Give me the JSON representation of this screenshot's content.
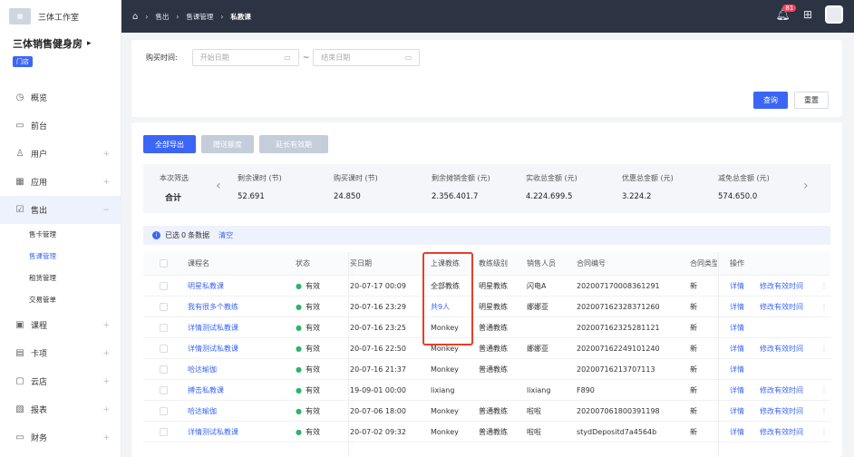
{
  "sidebar": {
    "brand": "三体工作室",
    "store_name": "三体销售健身房",
    "store_tag": "门店",
    "items": [
      {
        "label": "概览",
        "icon": "◷",
        "icon_name": "overview-icon",
        "expandable": false
      },
      {
        "label": "前台",
        "icon": "▭",
        "icon_name": "monitor-icon",
        "expandable": false
      },
      {
        "label": "用户",
        "icon": "♙",
        "icon_name": "user-icon",
        "expandable": true
      },
      {
        "label": "应用",
        "icon": "▦",
        "icon_name": "apps-icon",
        "expandable": true
      },
      {
        "label": "售出",
        "icon": "☑",
        "icon_name": "sales-icon",
        "expandable": true,
        "active": true
      }
    ],
    "sub_items": [
      {
        "label": "售卡管理",
        "active": false
      },
      {
        "label": "售课管理",
        "active": true
      },
      {
        "label": "租赁管理",
        "active": false
      },
      {
        "label": "交易管单",
        "active": false
      }
    ],
    "items2": [
      {
        "label": "课程",
        "icon": "▣",
        "icon_name": "course-icon"
      },
      {
        "label": "卡项",
        "icon": "▤",
        "icon_name": "card-icon"
      },
      {
        "label": "云店",
        "icon": "▢",
        "icon_name": "store-icon"
      },
      {
        "label": "报表",
        "icon": "▧",
        "icon_name": "report-icon"
      },
      {
        "label": "财务",
        "icon": "▭",
        "icon_name": "finance-icon"
      }
    ]
  },
  "topbar": {
    "breadcrumb": [
      "售出",
      "售课管理",
      "私教课"
    ],
    "badge": "81"
  },
  "filter": {
    "label": "购买时间:",
    "start_placeholder": "开始日期",
    "end_placeholder": "结束日期",
    "tilde": "~",
    "query": "查询",
    "reset": "重置"
  },
  "actions": {
    "export_all": "全部导出",
    "gift_quota": "赠送额度",
    "extend": "延长有效期"
  },
  "summary": {
    "label": "本次筛选",
    "total": "合计",
    "columns": [
      {
        "title": "剩余课时 (节)",
        "value": "52.691"
      },
      {
        "title": "购买课时 (节)",
        "value": "24.850"
      },
      {
        "title": "剩余摊销金额 (元)",
        "value": "2.356.401.7"
      },
      {
        "title": "实收总金额 (元)",
        "value": "4.224.699.5"
      },
      {
        "title": "优惠总金额 (元)",
        "value": "3.224.2"
      },
      {
        "title": "减免总金额 (元)",
        "value": "574.650.0"
      }
    ]
  },
  "selection": {
    "prefix": "已选",
    "count": "0",
    "suffix": "条数据",
    "clear": "清空"
  },
  "table": {
    "headers": {
      "name": "课程名",
      "status": "状态",
      "date": "买日期",
      "coach": "上课教练",
      "level": "教练级别",
      "sales": "销售人员",
      "contract": "合同编号",
      "ctype": "合同类型",
      "ops": "操作"
    },
    "rows": [
      {
        "name": "明星私教课",
        "status": "有效",
        "date": "20-07-17 00:09",
        "coach": "全部教练",
        "level": "明星教练",
        "sales": "闪电A",
        "contract": "202007170008361291",
        "ctype": "新",
        "op1": "详情",
        "op2": "修改有效时间",
        "more": true
      },
      {
        "name": "我有很多个教练",
        "status": "有效",
        "date": "20-07-16 23:29",
        "coach": "共9人",
        "coach_link": true,
        "level": "明星教练",
        "sales": "娜娜亚",
        "contract": "202007162328371260",
        "ctype": "新",
        "op1": "详情",
        "op2": "修改有效时间",
        "more": true
      },
      {
        "name": "详情测试私教课",
        "status": "有效",
        "date": "20-07-16 23:25",
        "coach": "Monkey",
        "level": "普通教练",
        "sales": "",
        "contract": "202007162325281121",
        "ctype": "新",
        "op1": "详情",
        "op2": "",
        "more": false
      },
      {
        "name": "详情测试私教课",
        "status": "有效",
        "date": "20-07-16 22:50",
        "coach": "Monkey",
        "level": "普通教练",
        "sales": "娜娜亚",
        "contract": "202007162249101240",
        "ctype": "新",
        "op1": "详情",
        "op2": "修改有效时间",
        "more": true
      },
      {
        "name": "哈达瑜伽",
        "status": "有效",
        "date": "20-07-16 21:37",
        "coach": "Monkey",
        "level": "普通教练",
        "sales": "",
        "contract": "20200716213707113",
        "ctype": "新",
        "op1": "详情",
        "op2": "",
        "more": false
      },
      {
        "name": "搏击私教课",
        "status": "有效",
        "date": "19-09-01 00:00",
        "coach": "lixiang",
        "level": "",
        "sales": "lixiang",
        "contract": "F890",
        "ctype": "新",
        "op1": "详情",
        "op2": "修改有效时间",
        "more": true
      },
      {
        "name": "哈达瑜伽",
        "status": "有效",
        "date": "20-07-06 18:00",
        "coach": "Monkey",
        "level": "普通教练",
        "sales": "啦啦",
        "contract": "202007061800391198",
        "ctype": "新",
        "op1": "详情",
        "op2": "修改有效时间",
        "more": true
      },
      {
        "name": "详情测试私教课",
        "status": "有效",
        "date": "20-07-02 09:32",
        "coach": "Monkey",
        "level": "普通教练",
        "sales": "啦啦",
        "contract": "stydDepositd7a4564b",
        "ctype": "新",
        "op1": "详情",
        "op2": "修改有效时间",
        "more": true
      }
    ]
  }
}
